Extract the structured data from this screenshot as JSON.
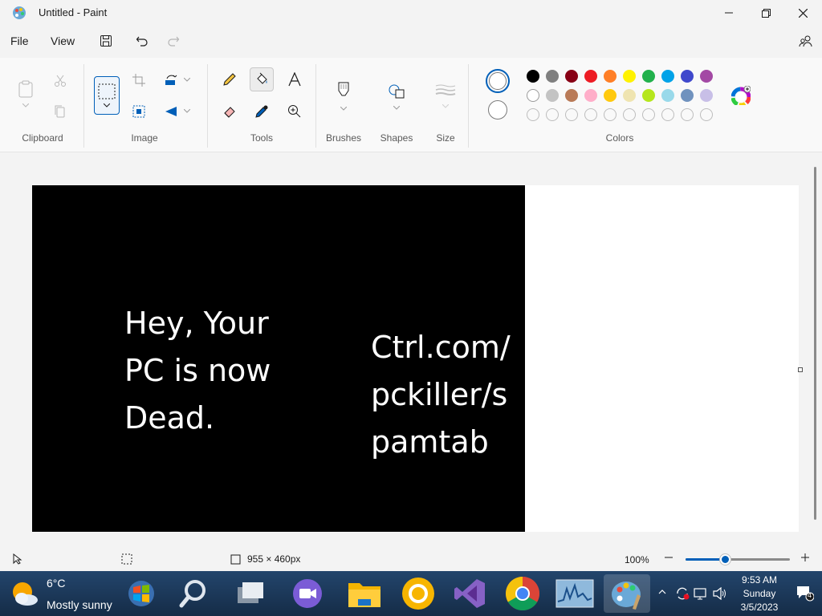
{
  "window": {
    "title": "Untitled - Paint"
  },
  "menu": {
    "file": "File",
    "view": "View"
  },
  "ribbon": {
    "groups": {
      "clipboard": "Clipboard",
      "image": "Image",
      "tools": "Tools",
      "brushes": "Brushes",
      "shapes": "Shapes",
      "size": "Size",
      "colors": "Colors"
    },
    "palette_row1": [
      "#000000",
      "#7f7f7f",
      "#880015",
      "#ed1c24",
      "#ff7f27",
      "#fff200",
      "#22b14c",
      "#00a2e8",
      "#3f48cc",
      "#a349a4"
    ],
    "palette_row2": [
      "#ffffff",
      "#c3c3c3",
      "#b97a57",
      "#ffaec9",
      "#ffc90e",
      "#efe4b0",
      "#b5e61d",
      "#99d9ea",
      "#7092be",
      "#c8bfe7"
    ]
  },
  "canvas": {
    "text_left": "Hey, Your\nPC is now\nDead.",
    "text_right": "Ctrl.com/\npckiller/s\npamtab"
  },
  "status": {
    "dimensions": "955 × 460px",
    "zoom": "100%",
    "zoom_level": 0.38
  },
  "taskbar": {
    "weather_temp": "6°C",
    "weather_desc": "Mostly sunny",
    "time": "9:53 AM",
    "day": "Sunday",
    "date": "3/5/2023",
    "notification_count": "4"
  }
}
